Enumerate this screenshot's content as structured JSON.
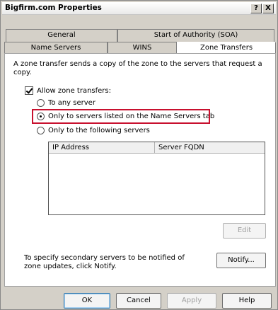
{
  "window": {
    "title": "Bigfirm.com Properties",
    "help_label": "?",
    "close_label": "X"
  },
  "tabs": {
    "row1": [
      {
        "label": "General"
      },
      {
        "label": "Start of Authority (SOA)"
      }
    ],
    "row2": [
      {
        "label": "Name Servers"
      },
      {
        "label": "WINS"
      },
      {
        "label": "Zone Transfers",
        "active": true
      }
    ]
  },
  "content": {
    "description": "A zone transfer sends a copy of the zone to the servers that request a copy.",
    "allow_checkbox": {
      "label": "Allow zone transfers:",
      "checked": true
    },
    "options": [
      {
        "label": "To any server",
        "selected": false
      },
      {
        "label": "Only to servers listed on the Name Servers tab",
        "selected": true
      },
      {
        "label": "Only to the following servers",
        "selected": false
      }
    ],
    "server_list": {
      "columns": [
        "IP Address",
        "Server FQDN"
      ],
      "rows": []
    },
    "edit_label": "Edit",
    "notify_note": "To specify secondary servers to be notified of zone updates, click Notify.",
    "notify_label": "Notify..."
  },
  "footer": {
    "ok_label": "OK",
    "cancel_label": "Cancel",
    "apply_label": "Apply",
    "help_label": "Help"
  },
  "colors": {
    "highlight": "#c8102e"
  }
}
